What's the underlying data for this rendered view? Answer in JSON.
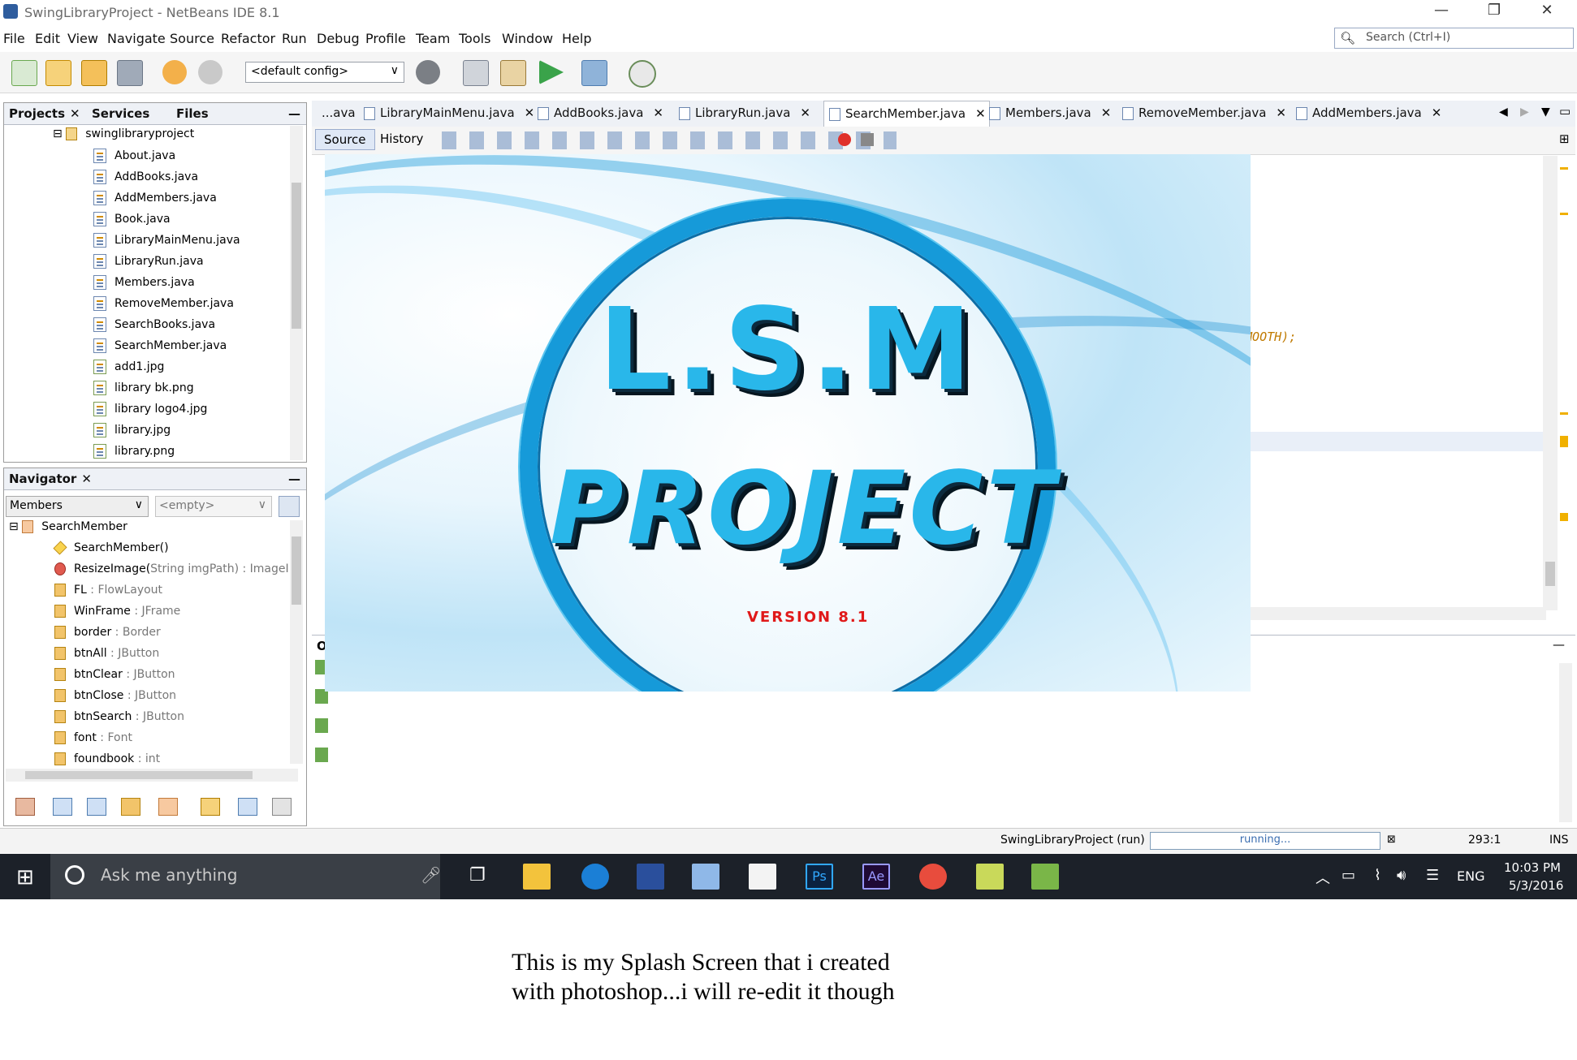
{
  "window": {
    "title": "SwingLibraryProject - NetBeans IDE 8.1",
    "controls": [
      "—",
      "❐",
      "✕"
    ]
  },
  "menu": [
    "File",
    "Edit",
    "View",
    "Navigate",
    "Source",
    "Refactor",
    "Run",
    "Debug",
    "Profile",
    "Team",
    "Tools",
    "Window",
    "Help"
  ],
  "search": {
    "placeholder": "Search (Ctrl+I)"
  },
  "toolbar": {
    "config": "<default config>"
  },
  "projects_panel": {
    "tabs": [
      "Projects",
      "Services",
      "Files"
    ],
    "package": "swinglibraryproject",
    "files": [
      "About.java",
      "AddBooks.java",
      "AddMembers.java",
      "Book.java",
      "LibraryMainMenu.java",
      "LibraryRun.java",
      "Members.java",
      "RemoveMember.java",
      "SearchBooks.java",
      "SearchMember.java",
      "add1.jpg",
      "library bk.png",
      "library logo4.jpg",
      "library.jpg",
      "library.png"
    ]
  },
  "navigator": {
    "tab": "Navigator",
    "filter": "Members",
    "empty": "<empty>",
    "root": "SearchMember",
    "items": [
      {
        "name": "SearchMember()",
        "type": ""
      },
      {
        "name": "ResizeImage(",
        "type": "String imgPath) : ImageI"
      },
      {
        "name": "FL",
        "type": " : FlowLayout"
      },
      {
        "name": "WinFrame",
        "type": " : JFrame"
      },
      {
        "name": "border",
        "type": " : Border"
      },
      {
        "name": "btnAll",
        "type": " : JButton"
      },
      {
        "name": "btnClear",
        "type": " : JButton"
      },
      {
        "name": "btnClose",
        "type": " : JButton"
      },
      {
        "name": "btnSearch",
        "type": " : JButton"
      },
      {
        "name": "font",
        "type": " : Font"
      },
      {
        "name": "foundbook",
        "type": " : int"
      }
    ]
  },
  "editor": {
    "tabs": [
      "...ava",
      "LibraryMainMenu.java",
      "AddBooks.java",
      "LibraryRun.java",
      "SearchMember.java",
      "Members.java",
      "RemoveMember.java",
      "AddMembers.java"
    ],
    "active_tab": "SearchMember.java",
    "views": [
      "Source",
      "History"
    ],
    "code_fragment": "SMOOTH);",
    "output_tab": "O"
  },
  "splash": {
    "line1": "L.S.M",
    "line2": "PROJECT",
    "version": "VERSION 8.1"
  },
  "status": {
    "project": "SwingLibraryProject (run)",
    "progress": "running...",
    "position": "293:1",
    "mode": "INS"
  },
  "taskbar": {
    "search_placeholder": "Ask me anything",
    "language": "ENG",
    "time": "10:03 PM",
    "date": "5/3/2016"
  },
  "caption": {
    "line1": "This is my Splash Screen that i created",
    "line2": "with photoshop...i will re-edit it though"
  },
  "colors": {
    "accent": "#169ad9",
    "splash_text": "#29b7ea",
    "version": "#e01919",
    "taskbar": "#1c2129"
  }
}
